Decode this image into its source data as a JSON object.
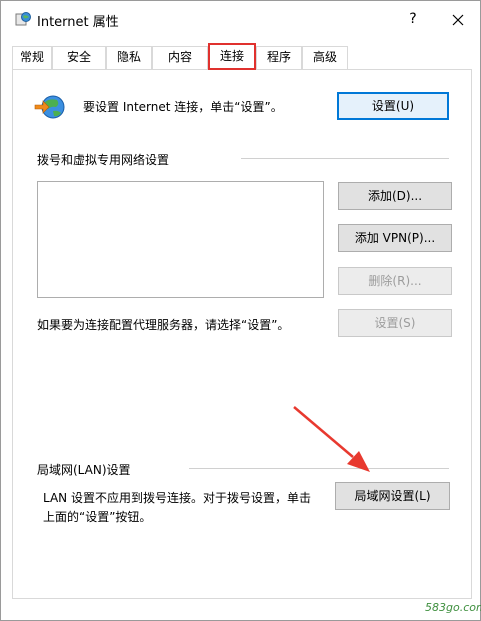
{
  "window": {
    "title": "Internet 属性",
    "help": "?",
    "close": "✕"
  },
  "tabs": [
    "常规",
    "安全",
    "隐私",
    "内容",
    "连接",
    "程序",
    "高级"
  ],
  "active_tab": "连接",
  "setup": {
    "text": "要设置 Internet 连接，单击“设置”。",
    "button": "设置(U)"
  },
  "dialup": {
    "heading": "拨号和虚拟专用网络设置",
    "add_button": "添加(D)...",
    "add_vpn_button": "添加 VPN(P)...",
    "remove_button": "删除(R)...",
    "proxy_text": "如果要为连接配置代理服务器，请选择“设置”。",
    "settings_button": "设置(S)"
  },
  "lan": {
    "heading": "局域网(LAN)设置",
    "text_line1": "LAN 设置不应用到拨号连接。对于拨号设置，单击",
    "text_line2": "上面的“设置”按钮。",
    "button": "局域网设置(L)"
  },
  "watermark": "583go.com",
  "colors": {
    "highlight": "#e0312e",
    "accent": "#0078d7"
  }
}
